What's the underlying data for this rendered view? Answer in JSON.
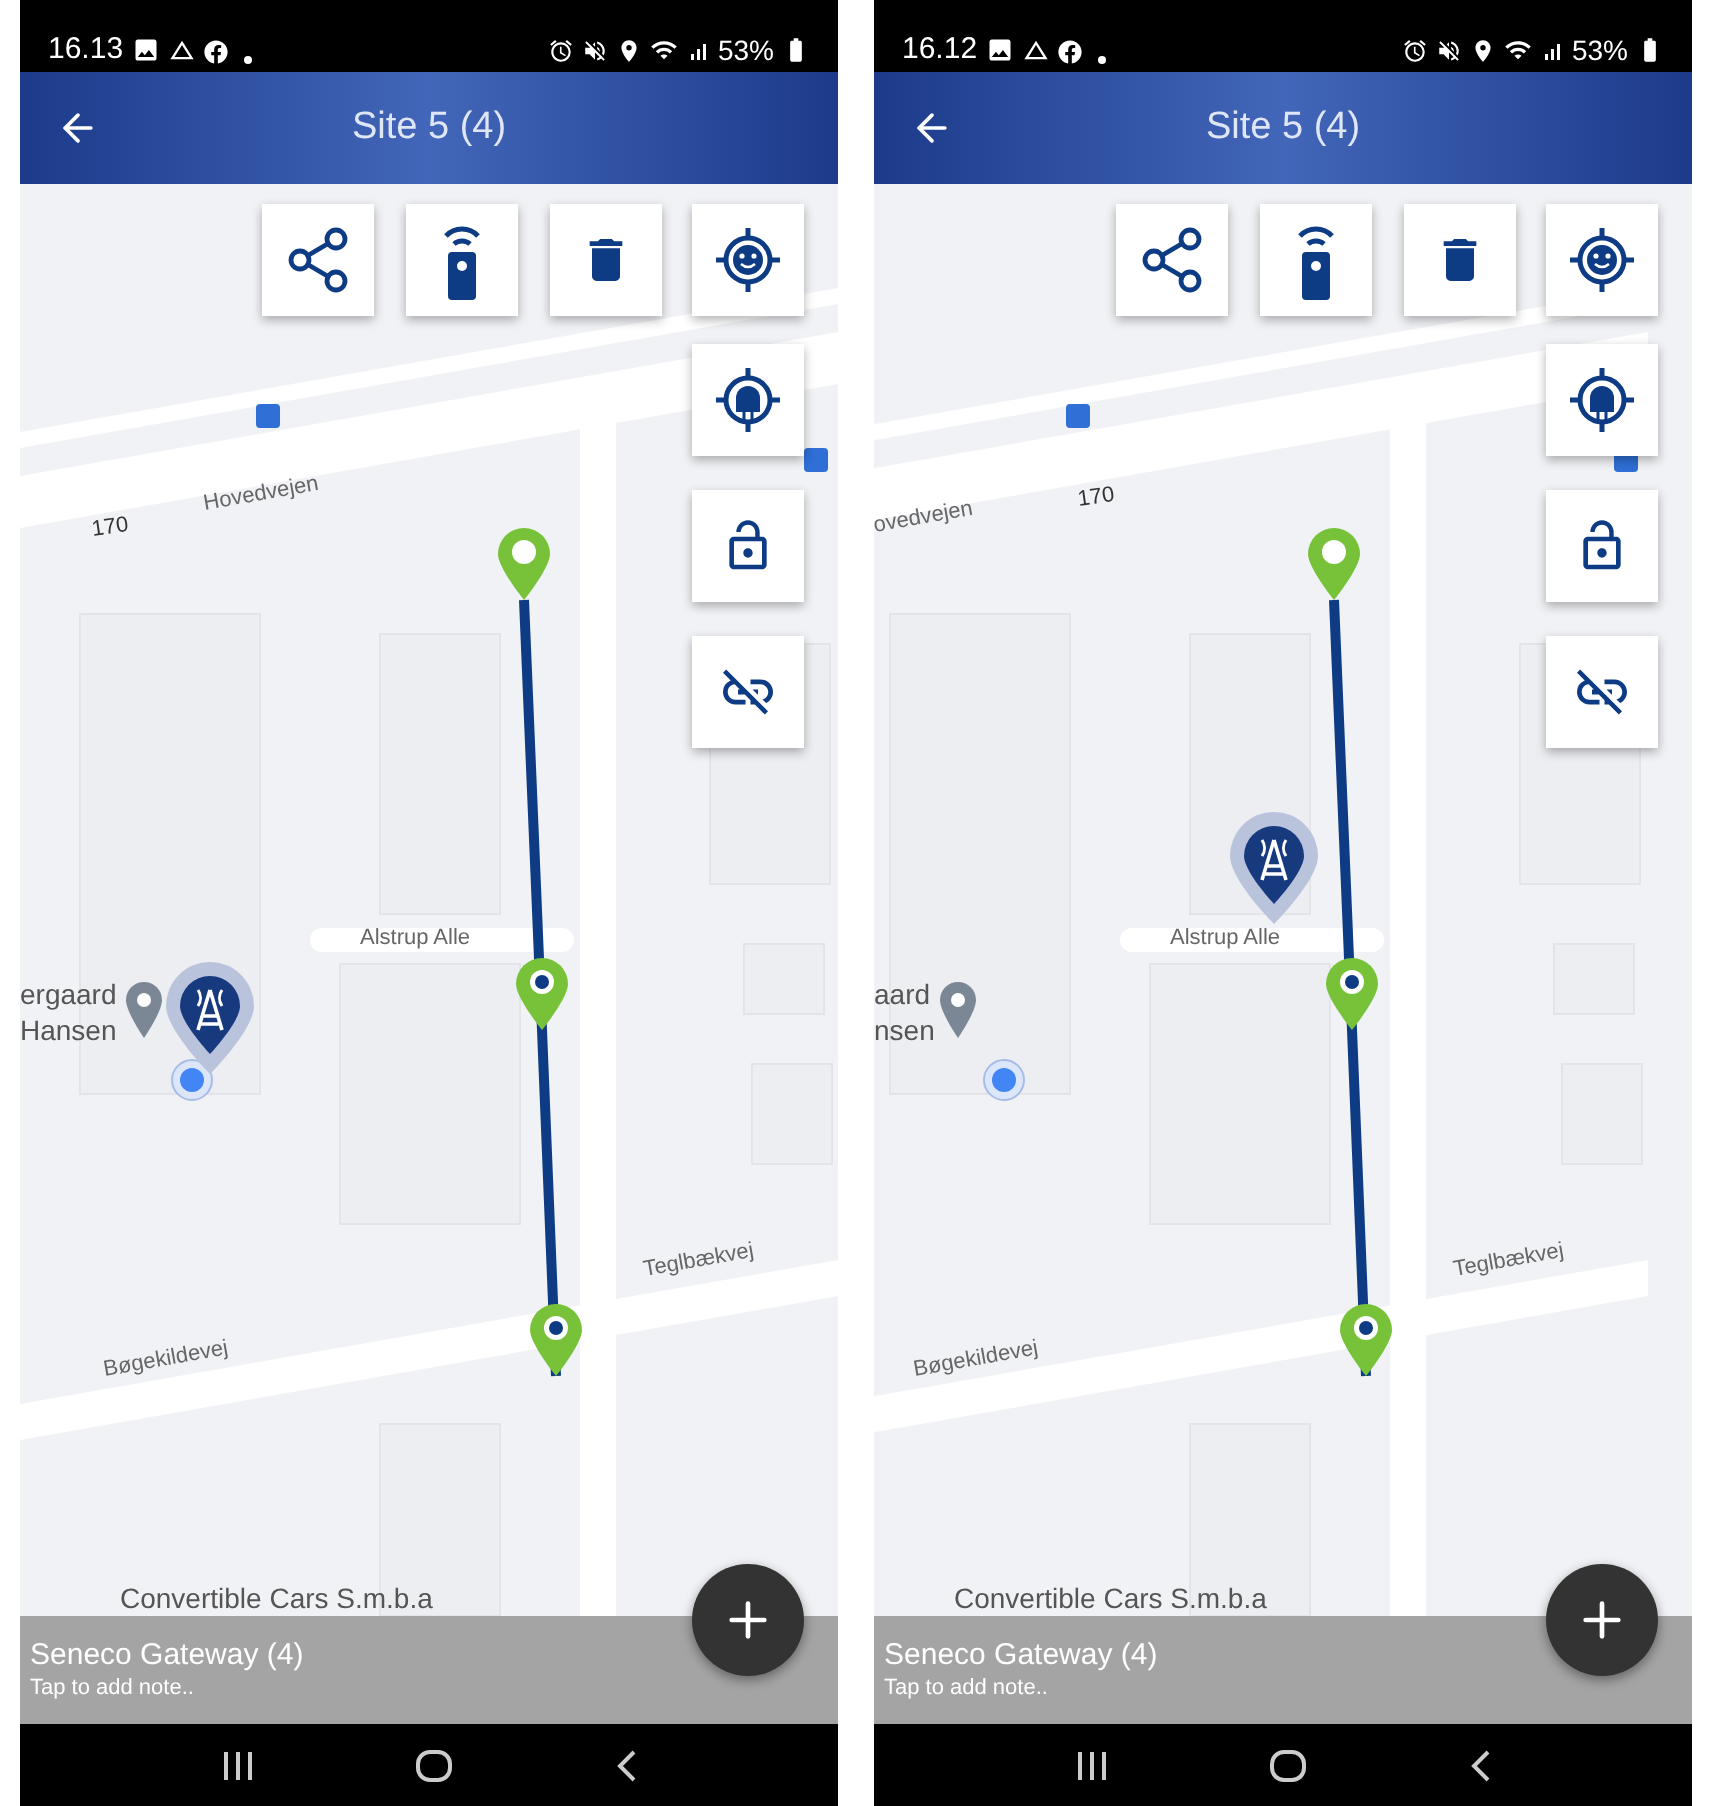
{
  "phones": [
    {
      "status_bar": {
        "time": "16.13",
        "battery": "53%"
      },
      "app_bar": {
        "title": "Site 5 (4)"
      },
      "map": {
        "labels": [
          "170",
          "Hovedvejen",
          "ergaard",
          "Hansen",
          "Alstrup Alle",
          "Teglbækvej",
          "Bøgekildevej",
          "Convertible Cars S.m.b.a"
        ]
      },
      "sheet": {
        "title": "Seneco Gateway (4)",
        "note": "Tap to add note.."
      }
    },
    {
      "status_bar": {
        "time": "16.12",
        "battery": "53%"
      },
      "app_bar": {
        "title": "Site 5 (4)"
      },
      "map": {
        "labels": [
          "ovedvejen",
          "170",
          "aard",
          "nsen",
          "Alstrup Alle",
          "Teglbækvej",
          "Bøgekildevej",
          "Convertible Cars S.m.b.a"
        ]
      },
      "sheet": {
        "title": "Seneco Gateway (4)",
        "note": "Tap to add note.."
      }
    }
  ]
}
